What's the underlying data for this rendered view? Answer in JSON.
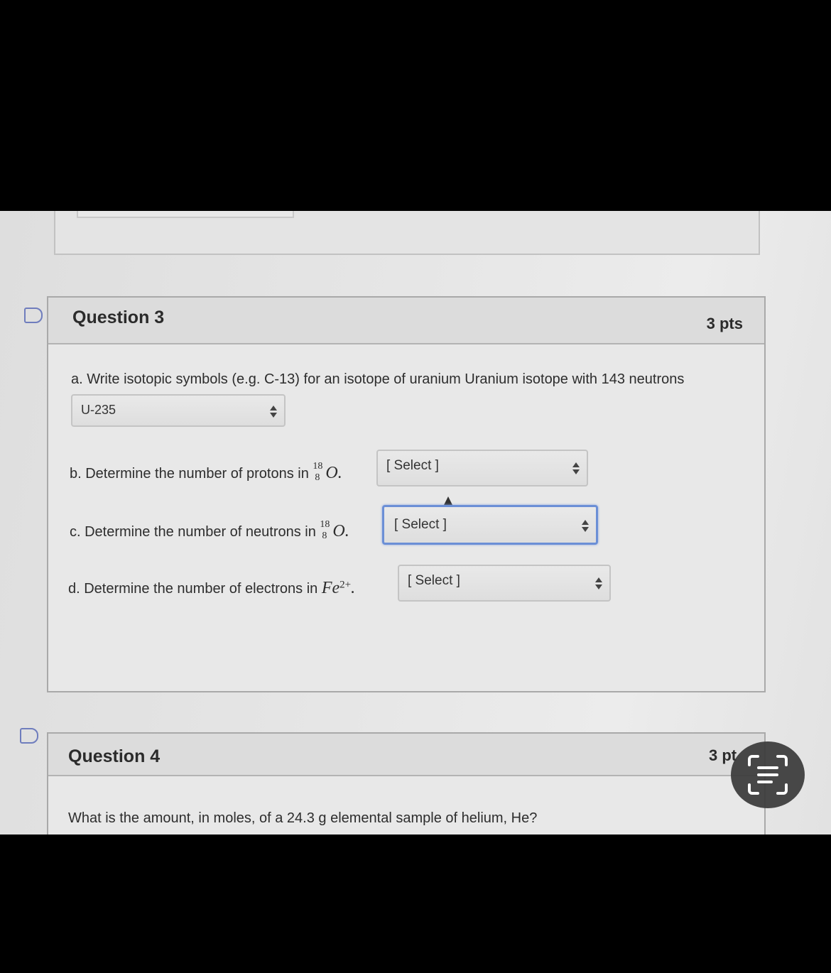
{
  "question3": {
    "title": "Question 3",
    "points": "3 pts",
    "part_a": {
      "text": "a. Write isotopic symbols (e.g. C-13) for an isotope of uranium Uranium isotope with 143 neutrons",
      "selected": "U-235"
    },
    "part_b": {
      "text": "b. Determine the number of protons in",
      "mass_number": "18",
      "atomic_number": "8",
      "element": "O",
      "punct": ".",
      "selected": "[ Select ]"
    },
    "part_c": {
      "text": "c. Determine the number of neutrons in",
      "mass_number": "18",
      "atomic_number": "8",
      "element": "O",
      "punct": ".",
      "selected": "[ Select ]"
    },
    "part_d": {
      "text": "d. Determine the number of electrons in",
      "element": "Fe",
      "charge": "2+",
      "punct": ".",
      "selected": "[ Select ]"
    }
  },
  "question4": {
    "title": "Question 4",
    "points": "3 pt",
    "text": "What is the amount, in moles, of a 24.3 g elemental sample of helium, He?"
  },
  "colors": {
    "flag": "#6f7dbd",
    "focus_ring": "#6b8fd6"
  },
  "icons": {
    "flag": "bookmark-flag-icon",
    "select_arrows": "updown-arrows-icon",
    "scan": "scan-text-icon"
  }
}
